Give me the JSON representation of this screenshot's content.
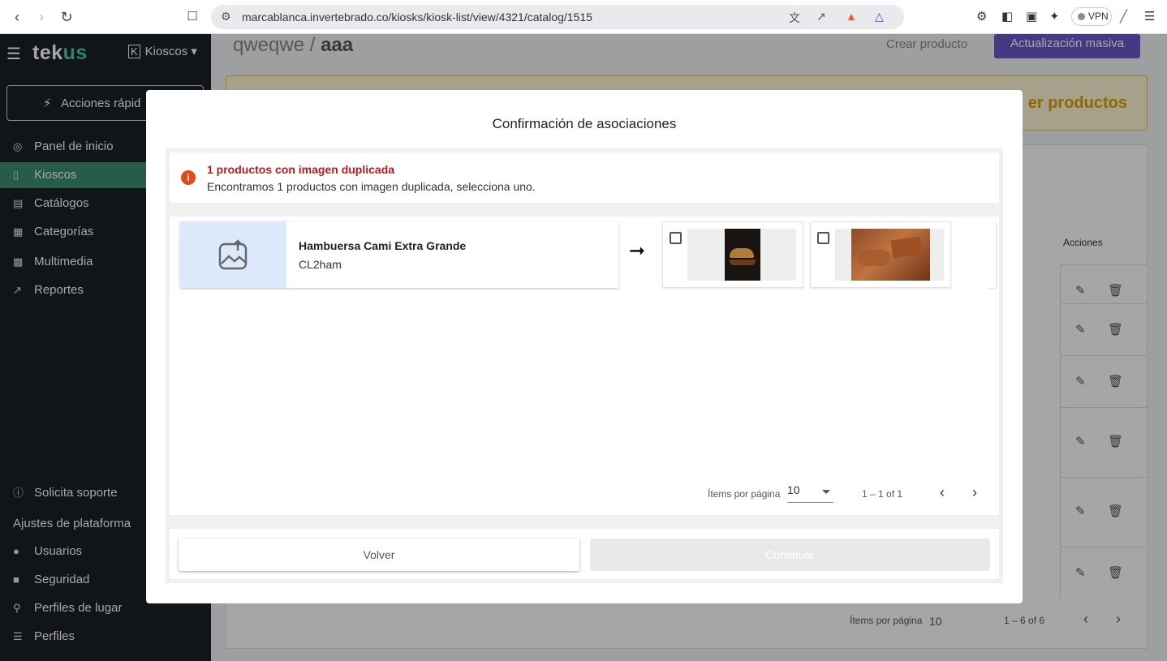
{
  "browser": {
    "url": "marcablanca.invertebrado.co/kiosks/kiosk-list/view/4321/catalog/1515",
    "vpn_label": "VPN",
    "shield_count": "3"
  },
  "sidebar": {
    "logo_main": "tek",
    "logo_accent": "us",
    "kiosk_selector": "Kioscos",
    "quick_actions": "Acciones rápid",
    "items": [
      {
        "label": "Panel de inicio",
        "icon": "dashboard-icon"
      },
      {
        "label": "Kioscos",
        "icon": "kiosk-icon",
        "active": true
      },
      {
        "label": "Catálogos",
        "icon": "book-icon"
      },
      {
        "label": "Categorías",
        "icon": "sitemap-icon"
      },
      {
        "label": "Multimedia",
        "icon": "media-icon"
      },
      {
        "label": "Reportes",
        "icon": "chart-icon"
      }
    ],
    "support": "Solicita soporte",
    "settings_section": "Ajustes de plataforma",
    "settings_items": [
      {
        "label": "Usuarios",
        "icon": "users-icon"
      },
      {
        "label": "Seguridad",
        "icon": "lock-icon"
      },
      {
        "label": "Perfiles de lugar",
        "icon": "place-profile-icon"
      },
      {
        "label": "Perfiles",
        "icon": "profiles-icon"
      }
    ]
  },
  "page": {
    "breadcrumb_a": "qweqwe",
    "breadcrumb_sep": "/",
    "breadcrumb_b": "aaa",
    "create_product": "Crear producto",
    "bulk_update": "Actualización masiva",
    "banner_text": "er productos",
    "actions_header": "Acciones",
    "pagination": {
      "items_per_page_label": "Ítems por página",
      "items_per_page_value": "10",
      "range": "1 – 6 of 6"
    }
  },
  "modal": {
    "title": "Confirmación de asociaciones",
    "alert": {
      "title": "1 productos con imagen duplicada",
      "subtitle": "Encontramos 1 productos con imagen duplicada, selecciona uno."
    },
    "item": {
      "name": "Hambuersa Cami Extra Grande",
      "code": "CL2ham"
    },
    "pagination": {
      "items_per_page_label": "Ítems por página",
      "items_per_page_value": "10",
      "range": "1 – 1 of 1"
    },
    "back_label": "Volver",
    "continue_label": "Continuar"
  }
}
